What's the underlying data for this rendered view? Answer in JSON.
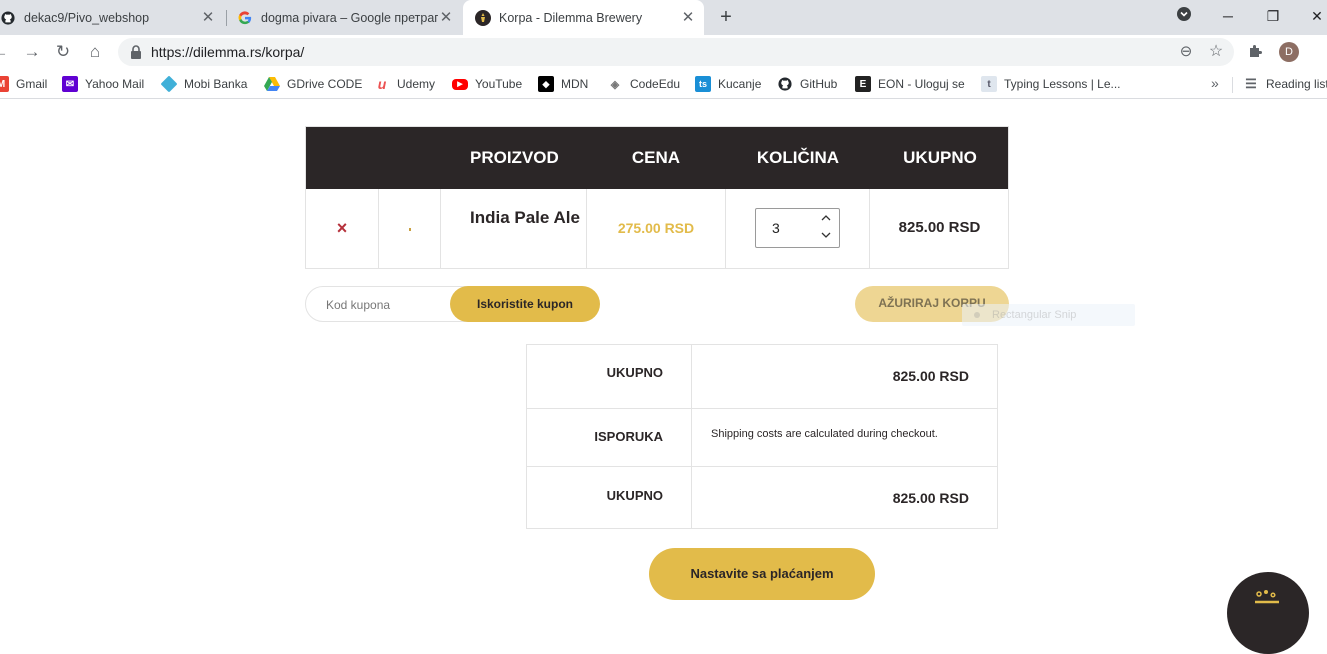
{
  "browser": {
    "tabs": [
      {
        "title": "dekac9/Pivo_webshop",
        "icon": "github-icon",
        "active": false
      },
      {
        "title": "dogma pivara – Google претрага",
        "icon": "google-icon",
        "active": false
      },
      {
        "title": "Korpa - Dilemma Brewery",
        "icon": "dilemma-icon",
        "active": true
      }
    ],
    "new_tab_label": "+",
    "url": "https://dilemma.rs/korpa/",
    "profile_initial": "D",
    "bookmarks": [
      {
        "label": "Gmail",
        "icon": "gmail-icon",
        "color": "#ea4335"
      },
      {
        "label": "Yahoo Mail",
        "icon": "yahoo-icon",
        "color": "#6001d2"
      },
      {
        "label": "Mobi Banka",
        "icon": "mobi-banka-icon",
        "color": "#40b0d8"
      },
      {
        "label": "GDrive CODE",
        "icon": "gdrive-icon",
        "color": "#34a853"
      },
      {
        "label": "Udemy",
        "icon": "udemy-icon",
        "color": "#ec5252"
      },
      {
        "label": "YouTube",
        "icon": "youtube-icon",
        "color": "#ff0000"
      },
      {
        "label": "MDN",
        "icon": "mdn-icon",
        "color": "#000000"
      },
      {
        "label": "CodeEdu",
        "icon": "codeedu-icon",
        "color": "#777777"
      },
      {
        "label": "Kucanje",
        "icon": "kucanje-icon",
        "color": "#1a8fd6"
      },
      {
        "label": "GitHub",
        "icon": "github-icon",
        "color": "#24292e"
      },
      {
        "label": "EON - Uloguj se",
        "icon": "eon-icon",
        "color": "#222222"
      },
      {
        "label": "Typing Lessons | Le...",
        "icon": "typing-lessons-icon",
        "color": "#9aa9b8"
      }
    ],
    "reading_list_label": "Reading list"
  },
  "cart": {
    "headers": {
      "product": "PROIZVOD",
      "price": "CENA",
      "quantity": "KOLIČINA",
      "total": "UKUPNO"
    },
    "items": [
      {
        "remove_label": "×",
        "name": "India Pale Ale",
        "price": "275.00 RSD",
        "quantity": "3",
        "total": "825.00 RSD"
      }
    ],
    "coupon_placeholder": "Kod kupona",
    "apply_coupon_label": "Iskoristite kupon",
    "update_cart_label": "AŽURIRAJ KORPU"
  },
  "totals": {
    "subtotal_label": "UKUPNO",
    "subtotal_value": "825.00 RSD",
    "shipping_label": "ISPORUKA",
    "shipping_note": "Shipping costs are calculated during checkout.",
    "total_label": "UKUPNO",
    "total_value": "825.00 RSD"
  },
  "checkout_label": "Nastavite sa plaćanjem",
  "overlay": {
    "snip_label": "Rectangular Snip"
  },
  "colors": {
    "accent": "#e2bb4a",
    "dark": "#2b2627",
    "remove": "#b5313b"
  }
}
